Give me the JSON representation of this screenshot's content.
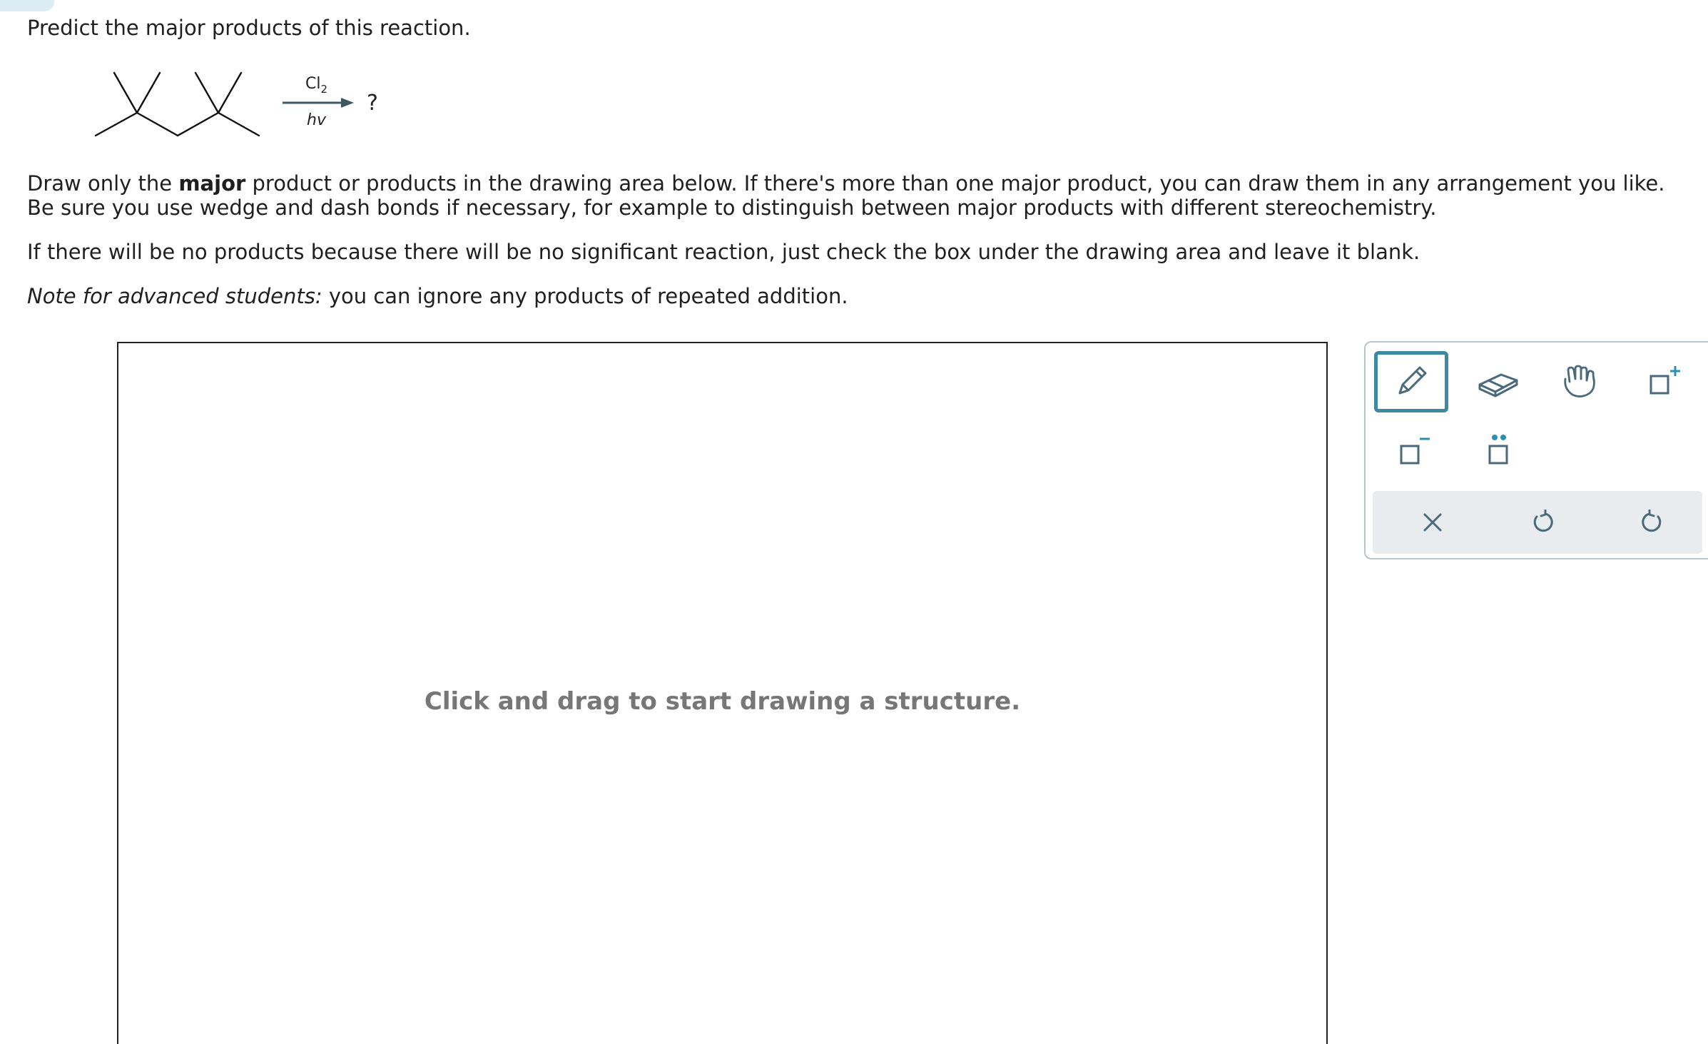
{
  "question": {
    "title": "Predict the major products of this reaction."
  },
  "reaction": {
    "reagent_top": "Cl",
    "reagent_top_sub": "2",
    "reagent_bottom": "hv",
    "product": "?"
  },
  "instructions": {
    "p1_a": "Draw only the ",
    "p1_bold": "major",
    "p1_b": " product or products in the drawing area below. If there's more than one major product, you can draw them in any arrangement you like.",
    "p1_c": "Be sure you use wedge and dash bonds if necessary, for example to distinguish between major products with different stereochemistry.",
    "p2": "If there will be no products because there will be no significant reaction, just check the box under the drawing area and leave it blank.",
    "p3_italic": "Note for advanced students:",
    "p3_rest": " you can ignore any products of repeated addition."
  },
  "canvas": {
    "hint": "Click and drag to start drawing a structure."
  },
  "toolbar": {
    "tools": [
      "pencil-icon",
      "eraser-icon",
      "hand-icon",
      "add-charge-icon",
      "remove-charge-icon",
      "lone-pair-icon"
    ],
    "actions": [
      "clear-icon",
      "undo-icon",
      "redo-icon"
    ],
    "accent": "#3d88a3",
    "icon_color": "#4a6a7c",
    "plus_color": "#2a8fb5"
  }
}
